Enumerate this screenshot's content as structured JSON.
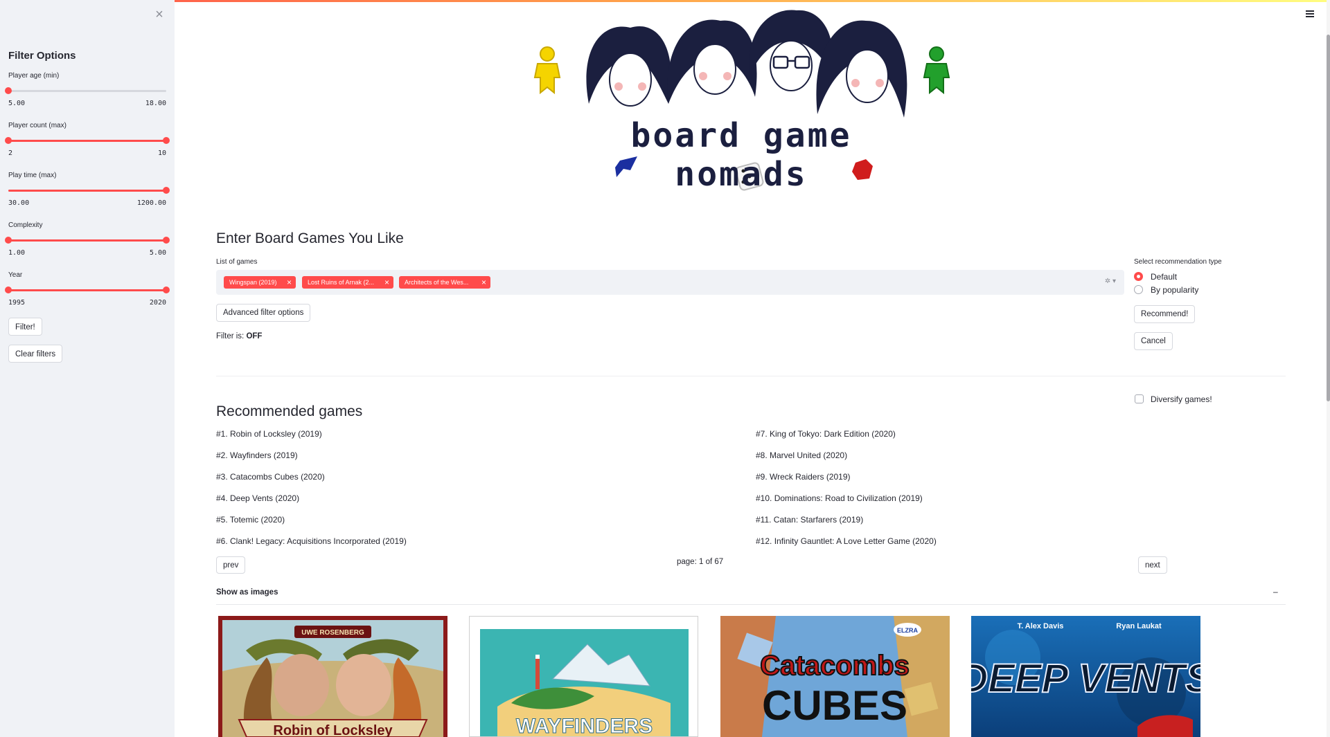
{
  "sidebar": {
    "title": "Filter Options",
    "sliders": [
      {
        "label": "Player age (min)",
        "min": "5.00",
        "max": "18.00",
        "low": 0,
        "high": 0
      },
      {
        "label": "Player count (max)",
        "min": "2",
        "max": "10",
        "low": 0,
        "high": 1
      },
      {
        "label": "Play time (max)",
        "min": "30.00",
        "max": "1200.00",
        "low": 0,
        "high": 1
      },
      {
        "label": "Complexity",
        "min": "1.00",
        "max": "5.00",
        "low": 0,
        "high": 1
      },
      {
        "label": "Year",
        "min": "1995",
        "max": "2020",
        "low": 0,
        "high": 1
      }
    ],
    "filter_button": "Filter!",
    "clear_button": "Clear filters"
  },
  "logo": {
    "text": "board game nomads"
  },
  "input_section": {
    "heading": "Enter Board Games You Like",
    "list_label": "List of games",
    "tags": [
      "Wingspan (2019)",
      "Lost Ruins of Arnak (2...",
      "Architects of the Wes..."
    ],
    "advanced_button": "Advanced filter options",
    "filter_status_prefix": "Filter is: ",
    "filter_status_value": "OFF"
  },
  "rec_type": {
    "label": "Select recommendation type",
    "options": [
      "Default",
      "By popularity"
    ],
    "selected": "Default",
    "recommend_button": "Recommend!",
    "cancel_button": "Cancel"
  },
  "diversify": {
    "label": "Diversify games!",
    "checked": false
  },
  "results": {
    "heading": "Recommended games",
    "left": [
      "#1. Robin of Locksley (2019)",
      "#2. Wayfinders (2019)",
      "#3. Catacombs Cubes (2020)",
      "#4. Deep Vents (2020)",
      "#5. Totemic (2020)",
      "#6. Clank! Legacy: Acquisitions Incorporated (2019)"
    ],
    "right": [
      "#7. King of Tokyo: Dark Edition (2020)",
      "#8. Marvel United (2020)",
      "#9. Wreck Raiders (2019)",
      "#10. Dominations: Road to Civilization (2019)",
      "#11. Catan: Starfarers (2019)",
      "#12. Infinity Gauntlet: A Love Letter Game (2020)"
    ],
    "prev": "prev",
    "next": "next",
    "page": "page: 1 of 67"
  },
  "expander": {
    "label": "Show as images",
    "toggle": "–"
  },
  "covers": {
    "robin": {
      "top": "UWE ROSENBERG",
      "title": "Robin of Locksley"
    },
    "wayfinders": {
      "title": "WAYFINDERS"
    },
    "catacombs": {
      "badge": "ELZRA",
      "line1": "Catacombs",
      "line2": "CUBES"
    },
    "deepvents": {
      "author1": "T. Alex Davis",
      "author2": "Ryan Laukat",
      "title": "DEEP VENTS"
    }
  },
  "colors": {
    "accent": "#ff4b4b",
    "sidebar_bg": "#f0f2f6"
  }
}
